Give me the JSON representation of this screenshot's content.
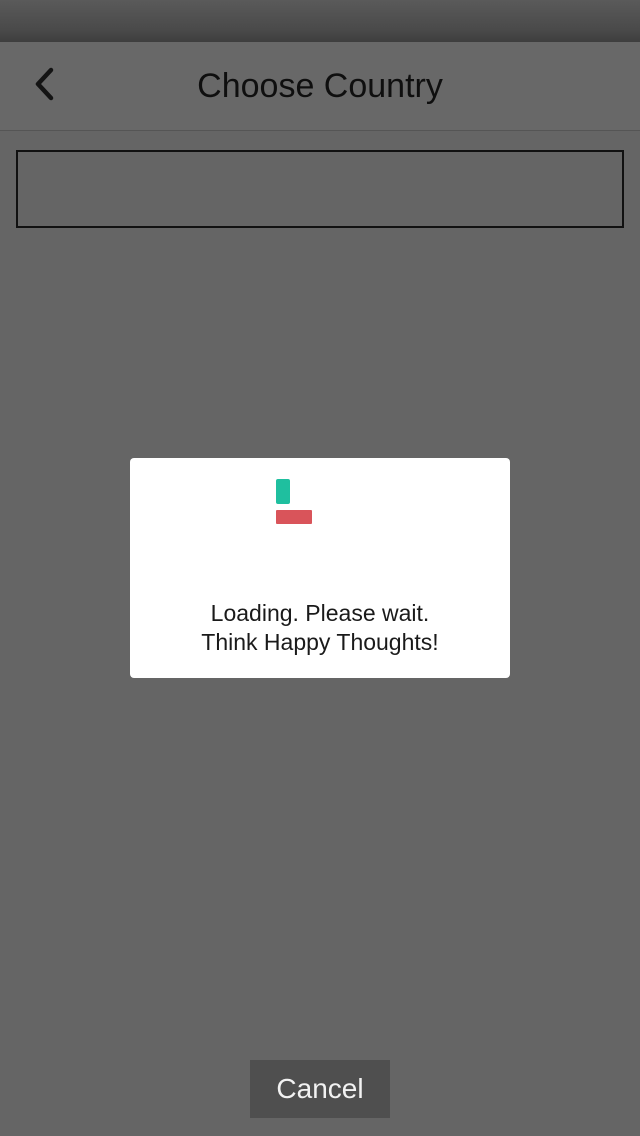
{
  "header": {
    "title": "Choose Country",
    "back_icon": "chevron-left-icon"
  },
  "search": {
    "value": "",
    "placeholder": ""
  },
  "loading_dialog": {
    "line1": "Loading. Please wait.",
    "line2": "Think Happy Thoughts!",
    "spinner_colors": {
      "top": "#1fbf9f",
      "bottom": "#d9545a"
    }
  },
  "footer": {
    "cancel_label": "Cancel"
  }
}
